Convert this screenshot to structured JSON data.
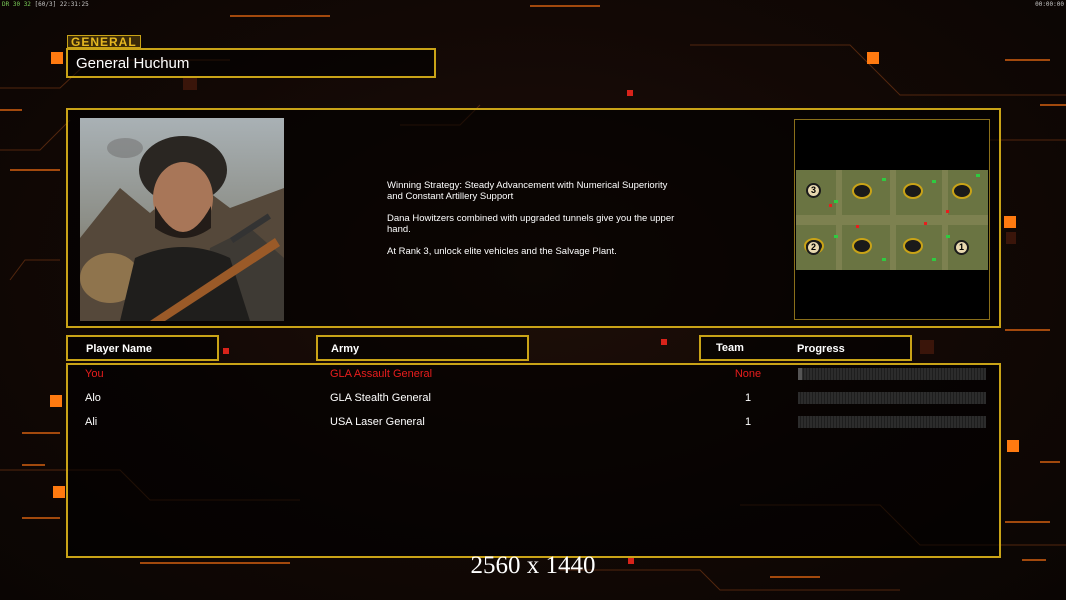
{
  "status_bar": {
    "left_a": "DR",
    "left_b": "30 32",
    "left_c": "[60/3]",
    "left_d": "22:31:25",
    "right": "00:00:00"
  },
  "general": {
    "tag": "GENERAL",
    "name": "General Huchum"
  },
  "strategy": {
    "line1": "Winning Strategy: Steady Advancement with Numerical Superiority\n and Constant Artillery Support",
    "line2": "Dana Howitzers combined with upgraded tunnels give you the upper\n hand.",
    "line3": "At Rank 3, unlock elite vehicles and the Salvage Plant."
  },
  "minimap": {
    "start_positions": [
      "3",
      "2",
      "1"
    ]
  },
  "headers": {
    "player_name": "Player Name",
    "army": "Army",
    "team": "Team",
    "progress": "Progress"
  },
  "players": [
    {
      "name": "You",
      "army": "GLA Assault General",
      "team": "None",
      "progress": 0.02,
      "highlight": "#e81d1d"
    },
    {
      "name": "Alo",
      "army": "GLA Stealth General",
      "team": "1",
      "progress": 0
    },
    {
      "name": "Ali",
      "army": "USA Laser General",
      "team": "1",
      "progress": 0
    }
  ],
  "resolution_label": "2560 x 1440",
  "colors": {
    "frame": "#c9a317",
    "accent_orange": "#ff7a10",
    "local_player": "#e81d1d"
  }
}
